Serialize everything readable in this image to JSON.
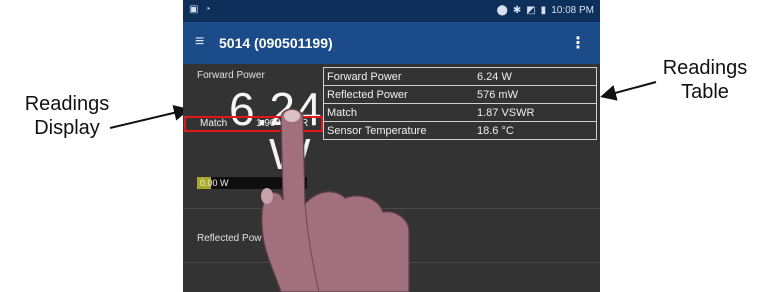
{
  "callouts": {
    "left": [
      "Readings",
      "Display"
    ],
    "right": [
      "Readings",
      "Table"
    ]
  },
  "status_bar": {
    "time": "10:08 PM"
  },
  "app_bar": {
    "title": "5014 (090501199)",
    "menu_icon": "hamburger-menu-icon",
    "overflow_icon": "overflow-vertical-icon"
  },
  "display": {
    "forward_power_label": "Forward Power",
    "big_value": "6.24",
    "big_unit": "W",
    "match_label": "Match",
    "match_value": "1.90 VSWR",
    "bar_start": "0.00 W",
    "bar_end": "50",
    "reflected_power_label": "Reflected Pow"
  },
  "readings_table": [
    {
      "name": "Forward Power",
      "value": "6.24 W"
    },
    {
      "name": "Reflected Power",
      "value": "576 mW"
    },
    {
      "name": "Match",
      "value": "1.87 VSWR"
    },
    {
      "name": "Sensor Temperature",
      "value": "18.6 °C"
    }
  ],
  "colors": {
    "status_bar": "#0e2f5a",
    "app_bar": "#1b4b88",
    "background": "#333333",
    "highlight": "#e01818",
    "bar_fill": "#a8a82a"
  }
}
